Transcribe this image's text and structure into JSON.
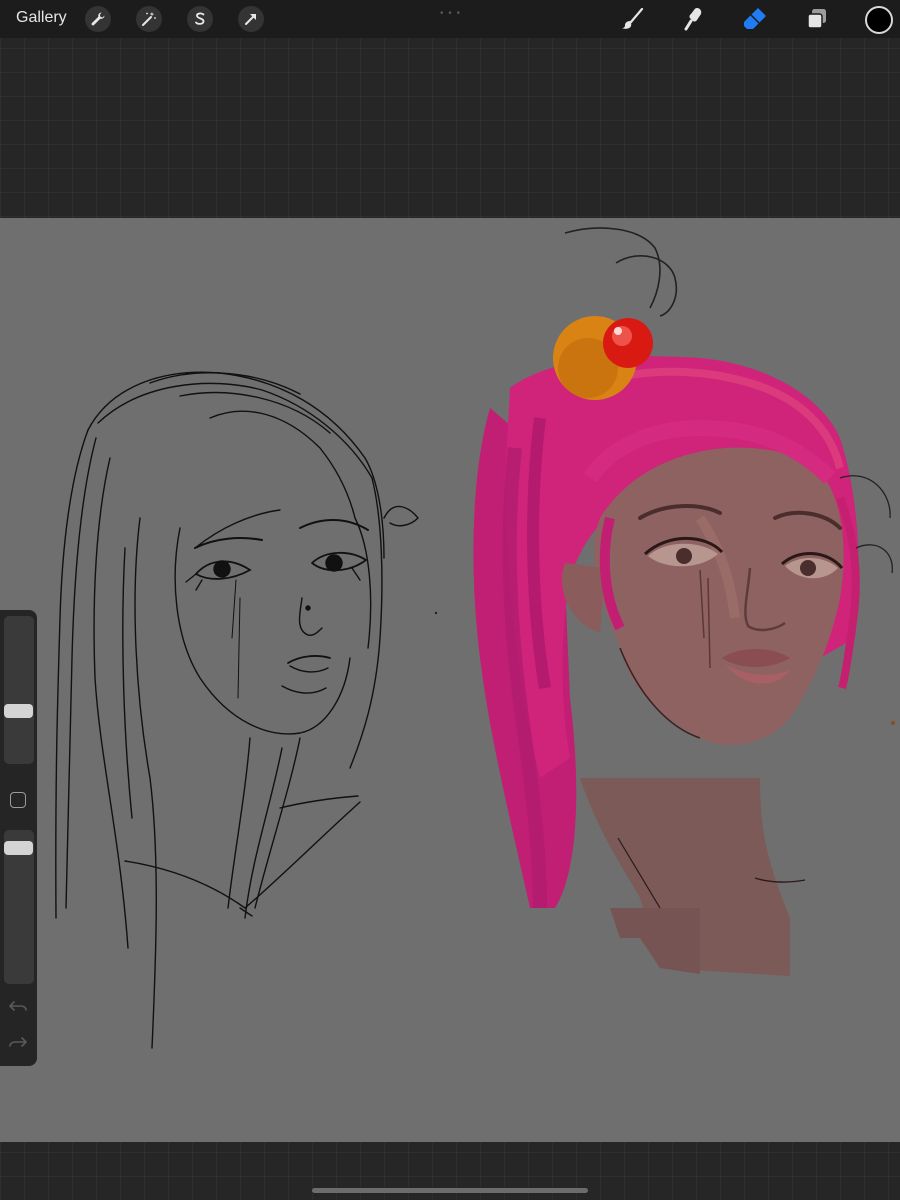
{
  "toolbar": {
    "gallery_label": "Gallery",
    "left_tools": [
      "wrench-icon",
      "magic-wand-icon",
      "selection-icon",
      "transform-arrow-icon"
    ],
    "right_tools": [
      "brush-icon",
      "smudge-icon",
      "eraser-icon",
      "layers-icon"
    ],
    "active_tool": "eraser-icon",
    "active_tool_color": "#1f7cf2",
    "current_color": "#000000"
  },
  "sidebar": {
    "brush_size": 0.34,
    "brush_opacity": 0.92
  },
  "colors": {
    "canvas": "#6f6f6f",
    "hair": "#d0237a",
    "skin": "#8c5f5a",
    "hair_bun": "#d98314",
    "bead": "#d81a12"
  }
}
